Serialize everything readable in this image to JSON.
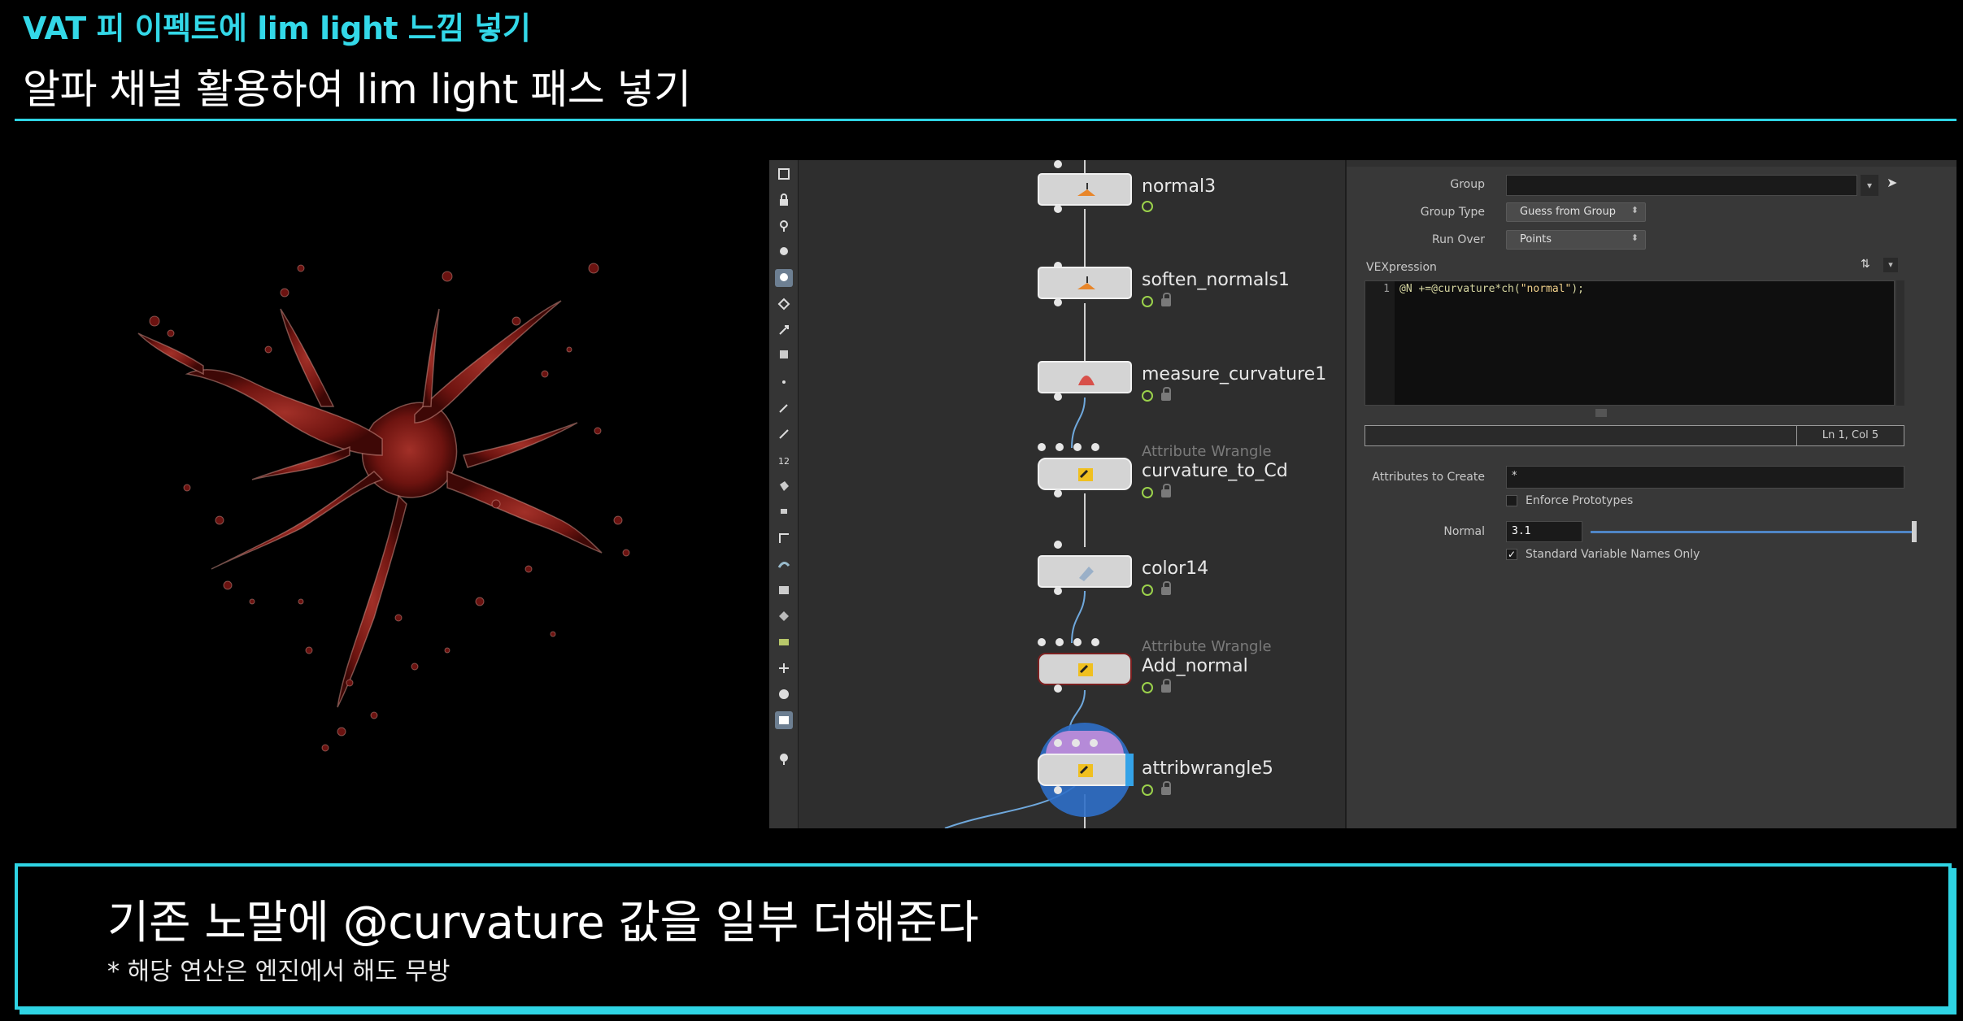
{
  "header": {
    "subtitle": "VAT 피 이펙트에 lim light 느낌 넣기",
    "title": "알파 채널 활용하여 lim light 패스 넣기"
  },
  "network": {
    "nodes": [
      {
        "name": "normal3",
        "type_label": "",
        "locked": false,
        "glyph": "normal-icon"
      },
      {
        "name": "soften_normals1",
        "type_label": "",
        "locked": true,
        "glyph": "normal-icon"
      },
      {
        "name": "measure_curvature1",
        "type_label": "",
        "locked": true,
        "glyph": "measure-icon"
      },
      {
        "name": "curvature_to_Cd",
        "type_label": "Attribute Wrangle",
        "locked": true,
        "glyph": "wrangle-icon"
      },
      {
        "name": "color14",
        "type_label": "",
        "locked": true,
        "glyph": "color-icon"
      },
      {
        "name": "Add_normal",
        "type_label": "Attribute Wrangle",
        "locked": true,
        "glyph": "wrangle-icon"
      },
      {
        "name": "attribwrangle5",
        "type_label": "",
        "locked": true,
        "glyph": "wrangle-icon",
        "selected": true
      }
    ]
  },
  "params": {
    "group_label": "Group",
    "group_value": "",
    "group_type_label": "Group Type",
    "group_type_value": "Guess from Group",
    "run_over_label": "Run Over",
    "run_over_value": "Points",
    "vex_label": "VEXpression",
    "code_line_number": "1",
    "code_prefix": "@N +=@curvature*ch(",
    "code_string": "\"normal\"",
    "code_suffix": ");",
    "cursor_position": "Ln 1, Col 5",
    "attributes_to_create_label": "Attributes to Create",
    "attributes_to_create_value": "*",
    "enforce_prototypes_label": "Enforce Prototypes",
    "enforce_prototypes_checked": false,
    "normal_label": "Normal",
    "normal_value": "3.1",
    "normal_fraction": 1.0,
    "std_var_names_label": "Standard Variable Names Only",
    "std_var_names_checked": true,
    "std_var_names_mark": "✓"
  },
  "caption": {
    "main": "기존 노말에 @curvature 값을 일부 더해준다",
    "note": "* 해당 연산은 엔진에서 해도 무방"
  },
  "colors": {
    "accent": "#2fd4e4",
    "blood": "#7a1410",
    "node_selected_ring": "#3d7fd6"
  }
}
